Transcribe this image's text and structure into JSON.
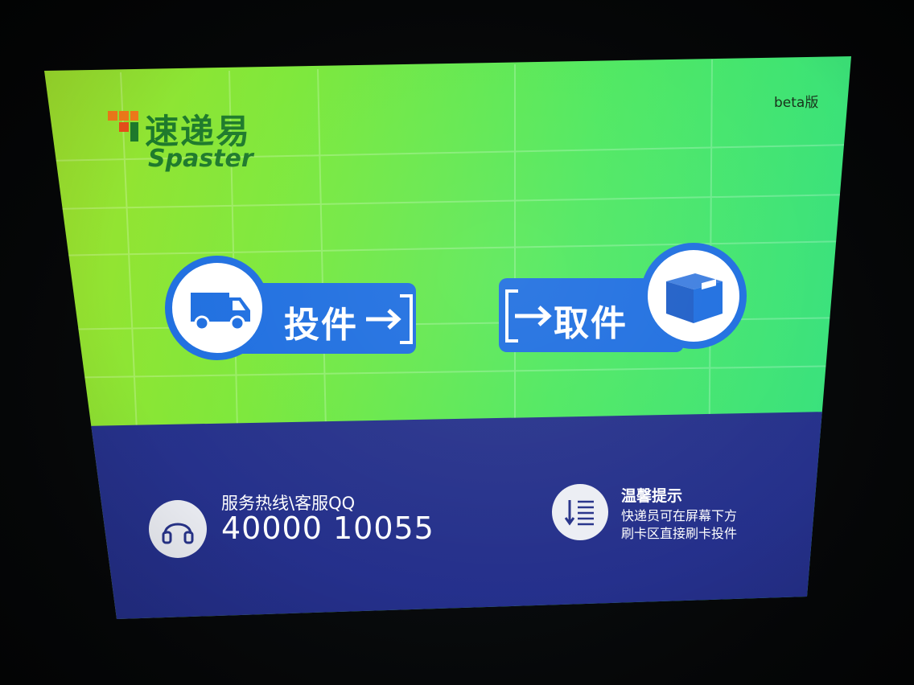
{
  "header": {
    "version_label": "beta版"
  },
  "logo": {
    "cn_name": "速递易",
    "en_name": "Spaster",
    "mark_color": "#f07a1a"
  },
  "actions": {
    "deliver": {
      "label": "投件",
      "icon": "delivery-van-icon"
    },
    "pickup": {
      "label": "取件",
      "icon": "package-box-icon"
    }
  },
  "footer": {
    "hotline": {
      "title": "服务热线\\客服QQ",
      "number": "40000 10055",
      "icon": "headphones-icon"
    },
    "tip": {
      "title": "温馨提示",
      "lines": [
        "快递员可在屏幕下方",
        "刷卡区直接刷卡投件"
      ],
      "icon": "list-sort-icon"
    }
  },
  "colors": {
    "accent_blue": "#1f6fe0",
    "footer_navy": "#27338a",
    "top_green": "#7de83a",
    "logo_green": "#1e7a2c"
  }
}
